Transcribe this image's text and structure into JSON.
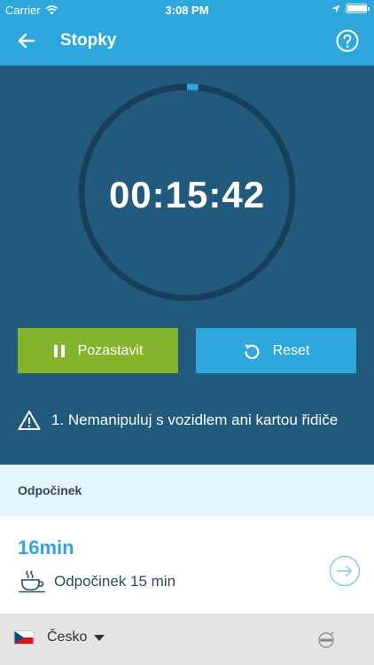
{
  "status_bar": {
    "carrier": "Carrier",
    "time": "3:08 PM",
    "icons": [
      "wifi-icon",
      "location-icon",
      "battery-icon"
    ],
    "battery_level": 0.95
  },
  "header": {
    "title": "Stopky",
    "back_icon": "arrow-left-icon",
    "help_icon": "question-circle-icon"
  },
  "timer": {
    "display": "00:15:42",
    "progress": 0.017
  },
  "actions": {
    "pause_label": "Pozastavit",
    "pause_icon": "pause-icon",
    "reset_label": "Reset",
    "reset_icon": "reset-icon"
  },
  "warning": {
    "icon": "warning-icon",
    "text": "1. Nemanipuluj s vozidlem ani kartou řidiče"
  },
  "section": {
    "title": "Odpočinek"
  },
  "break_card": {
    "duration": "16min",
    "icon": "coffee-cup-icon",
    "label": "Odpočinek 15 min",
    "arrow_icon": "arrow-right-circle-icon"
  },
  "footer": {
    "language": "Česko",
    "flag_icon": "czech-flag-icon",
    "logo_icon": "brand-logo-icon"
  },
  "colors": {
    "header_blue": "#2ea8dc",
    "panel_blue": "#225a7e",
    "ring_dark": "#173f5a",
    "pause_green": "#84b42c",
    "reset_blue": "#2ea8dc",
    "section_bg": "#e6f4fb",
    "footer_bg": "#e4e4e4"
  }
}
